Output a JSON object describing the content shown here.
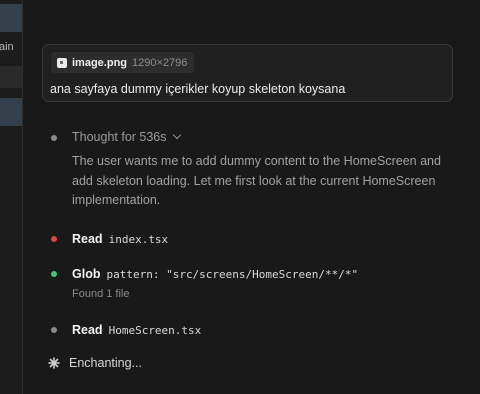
{
  "sidebar": {
    "partial_label": "ain"
  },
  "message": {
    "attachment": {
      "name": "image.png",
      "dimensions": "1290×2796",
      "icon": "image-file-icon"
    },
    "text": "ana sayfaya dummy içerikler koyup skeleton koysana"
  },
  "thought": {
    "label": "Thought for 536s",
    "body": "The user wants me to add dummy content to the HomeScreen and add skeleton loading. Let me first look at the current HomeScreen implementation."
  },
  "steps": [
    {
      "tool": "Read",
      "arg": "index.tsx",
      "status_color": "#d8463e"
    },
    {
      "tool": "Glob",
      "arg": "pattern: \"src/screens/HomeScreen/**/*\"",
      "sub": "Found 1 file",
      "status_color": "#41c57a"
    },
    {
      "tool": "Read",
      "arg": "HomeScreen.tsx",
      "status_color": "#8a8a8a"
    }
  ],
  "status": {
    "text": "Enchanting...",
    "icon": "sparkle-icon"
  }
}
